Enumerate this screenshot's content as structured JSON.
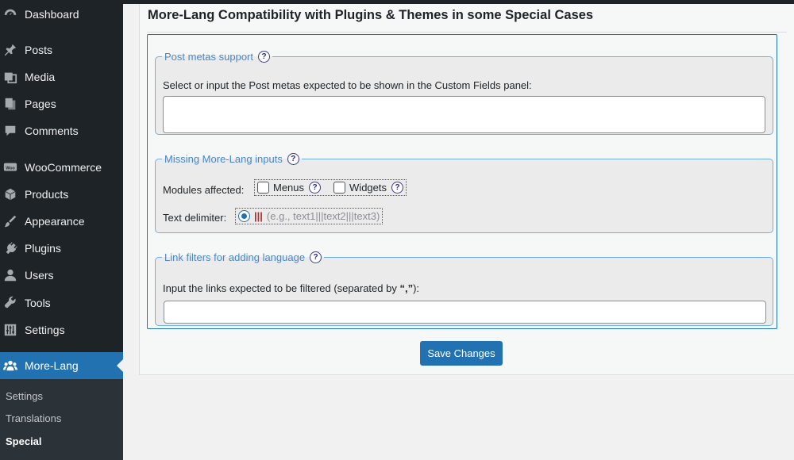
{
  "sidebar": {
    "items": [
      {
        "label": "Dashboard",
        "icon": "dashboard-icon"
      },
      {
        "label": "Posts",
        "icon": "pin-icon"
      },
      {
        "label": "Media",
        "icon": "media-icon"
      },
      {
        "label": "Pages",
        "icon": "pages-icon"
      },
      {
        "label": "Comments",
        "icon": "comment-icon"
      },
      {
        "label": "WooCommerce",
        "icon": "woo-icon"
      },
      {
        "label": "Products",
        "icon": "box-icon"
      },
      {
        "label": "Appearance",
        "icon": "brush-icon"
      },
      {
        "label": "Plugins",
        "icon": "plug-icon"
      },
      {
        "label": "Users",
        "icon": "user-icon"
      },
      {
        "label": "Tools",
        "icon": "wrench-icon"
      },
      {
        "label": "Settings",
        "icon": "sliders-icon"
      },
      {
        "label": "More-Lang",
        "icon": "people-icon"
      }
    ],
    "submenu": [
      "Settings",
      "Translations",
      "Special"
    ]
  },
  "panel": {
    "title": "More-Lang Compatibility with Plugins & Themes in some Special Cases",
    "post_metas": {
      "legend": "Post metas support",
      "description": "Select or input the Post metas expected to be shown in the Custom Fields panel:",
      "value": ""
    },
    "missing_inputs": {
      "legend": "Missing More-Lang inputs",
      "modules_label": "Modules affected:",
      "menus_label": "Menus",
      "widgets_label": "Widgets",
      "delimiter_label": "Text delimiter:",
      "delimiter_value": "|||",
      "delimiter_example": "(e.g., text1|||text2|||text3)"
    },
    "link_filters": {
      "legend": "Link filters for adding language",
      "description_pre": "Input the links expected to be filtered (separated by ",
      "comma": "“,”",
      "description_post": "):",
      "value": ""
    },
    "help_glyph": "?",
    "save_label": "Save Changes"
  },
  "colors": {
    "sidebar_bg": "#1d2327",
    "accent": "#2271b1",
    "legend_text": "#4a86c5"
  }
}
